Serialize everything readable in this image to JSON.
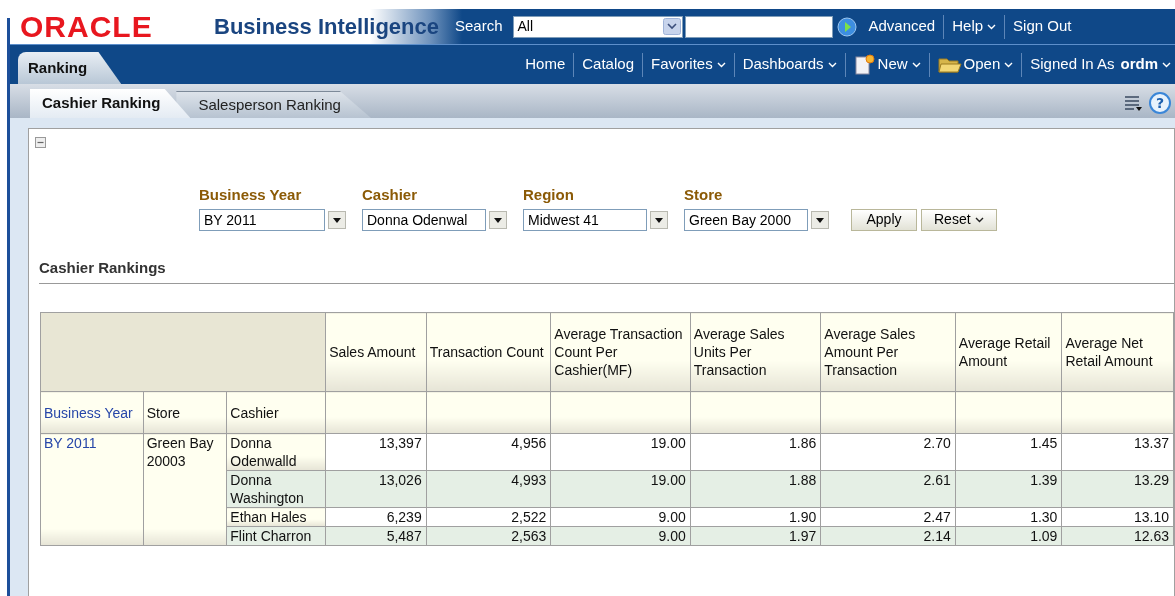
{
  "header": {
    "logo": "ORACLE",
    "product": "Business Intelligence",
    "search": {
      "label": "Search",
      "scope": "All"
    },
    "links": [
      {
        "label": "Advanced",
        "dropdown": false
      },
      {
        "label": "Help",
        "dropdown": true
      },
      {
        "label": "Sign Out",
        "dropdown": false
      }
    ]
  },
  "nav": {
    "dashboard_tab": "Ranking",
    "links": [
      {
        "label": "Home",
        "dropdown": false
      },
      {
        "label": "Catalog",
        "dropdown": false
      },
      {
        "label": "Favorites",
        "dropdown": true
      },
      {
        "label": "Dashboards",
        "dropdown": true
      },
      {
        "label": "New",
        "dropdown": true
      },
      {
        "label": "Open",
        "dropdown": true
      }
    ],
    "signed_in": {
      "label": "Signed In As",
      "user": "ordm"
    }
  },
  "help_glyph": "?",
  "page_tabs": [
    {
      "label": "Cashier Ranking",
      "selected": true
    },
    {
      "label": "Salesperson Ranking",
      "selected": false
    }
  ],
  "prompts": [
    {
      "label": "Business Year",
      "value": "BY 2011"
    },
    {
      "label": "Cashier",
      "value": "Donna Odenwal"
    },
    {
      "label": "Region",
      "value": "Midwest 41"
    },
    {
      "label": "Store",
      "value": "Green Bay 2000"
    }
  ],
  "prompt_buttons": [
    {
      "label": "Apply",
      "dropdown": false
    },
    {
      "label": "Reset",
      "dropdown": true
    }
  ],
  "section_title": "Cashier Rankings",
  "table": {
    "row_headers": [
      "Business Year",
      "Store",
      "Cashier"
    ],
    "columns": [
      "Sales Amount",
      "Transaction Count",
      "Average Transaction Count Per Cashier(MF)",
      "Average Sales Units Per Transaction",
      "Average Sales Amount Per Transaction",
      "Average Retail Amount",
      "Average Net Retail Amount"
    ],
    "business_year": "BY 2011",
    "store": "Green Bay 20003",
    "rows": [
      {
        "cashier": "Donna Odenwalld",
        "values": [
          "13,397",
          "4,956",
          "19.00",
          "1.86",
          "2.70",
          "1.45",
          "13.37"
        ]
      },
      {
        "cashier": "Donna Washington",
        "values": [
          "13,026",
          "4,993",
          "19.00",
          "1.88",
          "2.61",
          "1.39",
          "13.29"
        ]
      },
      {
        "cashier": "Ethan Hales",
        "values": [
          "6,239",
          "2,522",
          "9.00",
          "1.90",
          "2.47",
          "1.30",
          "13.10"
        ]
      },
      {
        "cashier": "Flint Charron",
        "values": [
          "5,487",
          "2,563",
          "9.00",
          "1.97",
          "2.14",
          "1.09",
          "12.63"
        ]
      }
    ]
  }
}
